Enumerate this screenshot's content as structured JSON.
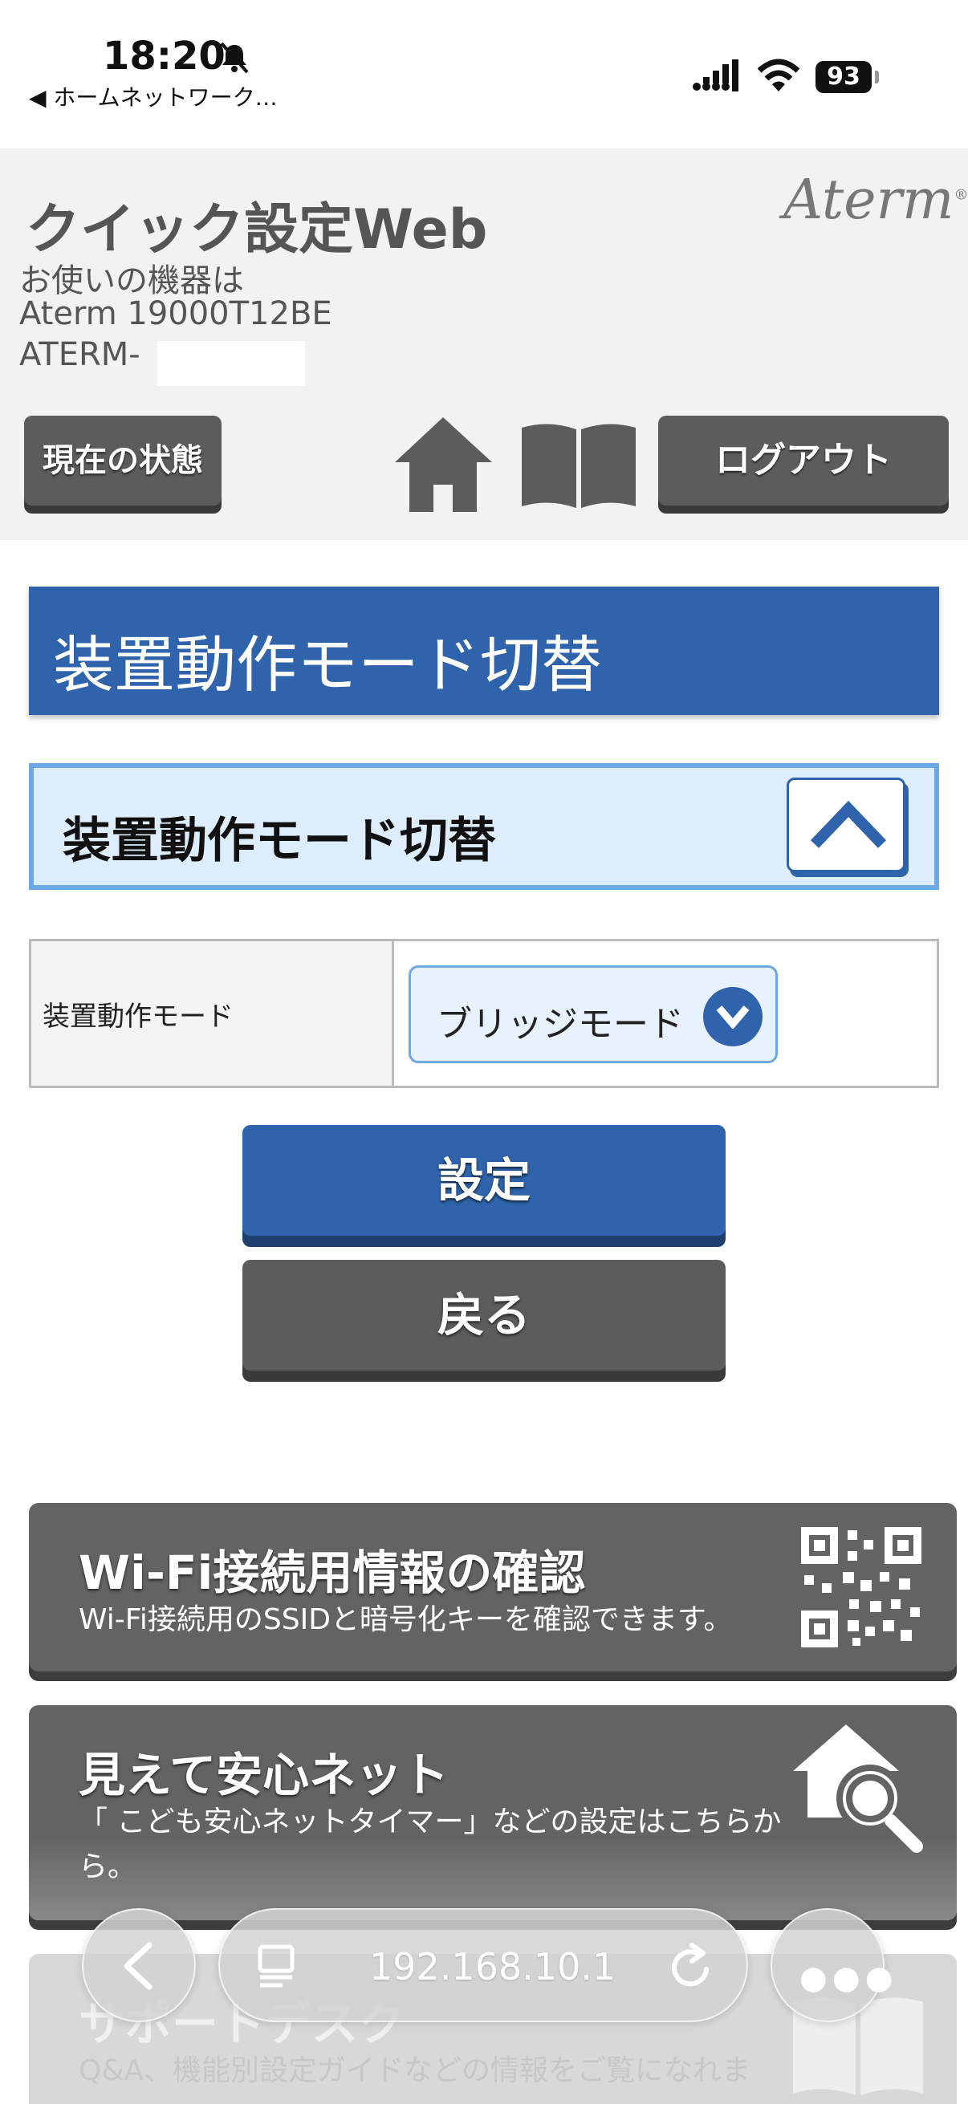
{
  "status_bar": {
    "time": "18:20",
    "back_label": "◀ ホームネットワーク…",
    "battery": "93"
  },
  "header": {
    "title": "クイック設定Web",
    "brand": "Aterm",
    "device_intro": "お使いの機器は",
    "device_model": "Aterm 19000T12BE",
    "device_ssid": "ATERM-",
    "status_button": "現在の状態",
    "logout_button": "ログアウト"
  },
  "main": {
    "page_title": "装置動作モード切替",
    "section_title": "装置動作モード切替",
    "setting_label": "装置動作モード",
    "mode_value": "ブリッジモード",
    "apply_button": "設定",
    "back_button": "戻る"
  },
  "cards": [
    {
      "title": "Wi-Fi接続用情報の確認",
      "description": "Wi-Fi接続用のSSIDと暗号化キーを確認できます。"
    },
    {
      "title": "見えて安心ネット",
      "description": "「 こども安心ネットタイマー」などの設定はこちらから。"
    },
    {
      "title": "サポートデスク",
      "description": "Q&A、機能別設定ガイドなどの情報をご覧になれま"
    }
  ],
  "browser": {
    "url": "192.168.10.1"
  },
  "colors": {
    "accent_blue": "#2f64ad",
    "light_blue": "#deedfb",
    "button_gray": "#5c5c5c"
  }
}
